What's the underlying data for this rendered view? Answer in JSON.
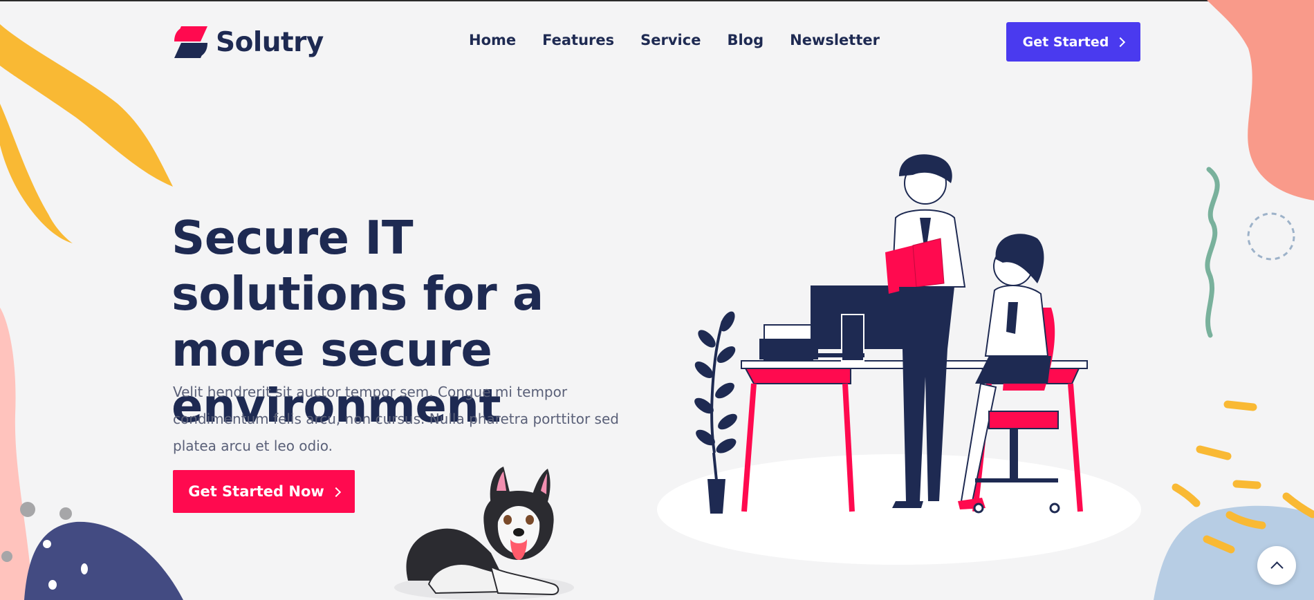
{
  "brand": {
    "name": "Solutry",
    "logo_icon": "solutry-s-logo-icon"
  },
  "nav": {
    "items": [
      "Home",
      "Features",
      "Service",
      "Blog",
      "Newsletter"
    ]
  },
  "header": {
    "cta_label": "Get Started",
    "cta_icon": "chevron-right-icon"
  },
  "hero": {
    "title": "Secure IT solutions for a more secure environment",
    "description": "Velit hendrerit sit auctor tempor sem. Congue mi tempor condimentum felis arcu, non cursus. Nulla pharetra porttitor sed platea arcu et leo odio.",
    "cta_label": "Get Started Now",
    "cta_icon": "chevron-right-icon"
  },
  "scroll_top": {
    "icon": "chevron-up-icon"
  },
  "colors": {
    "navy": "#1e2a52",
    "primary_button": "#4a3aef",
    "cta_button": "#ff0a4f",
    "background": "#f4f4f5",
    "accent_yellow": "#f9b934",
    "accent_salmon": "#f99a8a",
    "accent_green": "#79b19c",
    "accent_blue": "#b7cde4"
  }
}
